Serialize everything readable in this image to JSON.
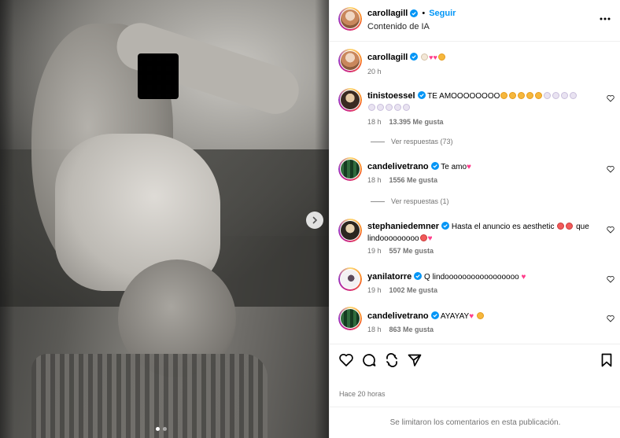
{
  "header": {
    "username": "carollagill",
    "separator": "•",
    "follow_label": "Seguir",
    "subtitle": "Contenido de IA"
  },
  "caption": {
    "username": "carollagill",
    "emojis": [
      "baby-bottle",
      "two-hearts",
      "smiling-face"
    ],
    "time": "20 h"
  },
  "comments": [
    {
      "username": "tinistoessel",
      "text": "TE AMOOOOOOOO",
      "emojis": [
        "crying-face",
        "crying-face",
        "crying-face",
        "crying-face",
        "crying-face",
        "white-heart",
        "white-heart",
        "white-heart",
        "white-heart",
        "white-heart",
        "white-heart",
        "white-heart",
        "white-heart",
        "white-heart"
      ],
      "time": "18 h",
      "likes": "13.395 Me gusta",
      "replies": "Ver respuestas (73)"
    },
    {
      "username": "candelivetrano",
      "text": "Te amo",
      "emojis": [
        "pink-heart"
      ],
      "time": "18 h",
      "likes": "1556 Me gusta",
      "replies": "Ver respuestas (1)"
    },
    {
      "username": "stephaniedemner",
      "text": "Hasta el anuncio es aesthetic",
      "text2": "que",
      "text3": "lindooooooooo",
      "emojis": [
        "heart-eyes",
        "heart-eyes"
      ],
      "emojis2": [
        "heart-eyes",
        "pink-heart"
      ],
      "time": "19 h",
      "likes": "557 Me gusta"
    },
    {
      "username": "yanilatorre",
      "text": "Q lindooooooooooooooooo",
      "emojis": [
        "pink-heart"
      ],
      "time": "19 h",
      "likes": "1002 Me gusta"
    },
    {
      "username": "candelivetrano",
      "text": "AYAYAY",
      "emojis": [
        "pink-heart",
        "smiling-face"
      ],
      "time": "18 h",
      "likes": "863 Me gusta"
    }
  ],
  "actions": [
    "heart-icon",
    "comment-icon",
    "share-icon",
    "send-icon",
    "bookmark-icon"
  ],
  "posted": "Hace 20 horas",
  "footer": "Se limitaron los comentarios en esta publicación.",
  "carousel": {
    "slides": 2,
    "active": 1
  },
  "colors": {
    "link": "#0095f6",
    "secondary": "#737373",
    "verified": "#0095f6",
    "heart": "#ff3040"
  }
}
